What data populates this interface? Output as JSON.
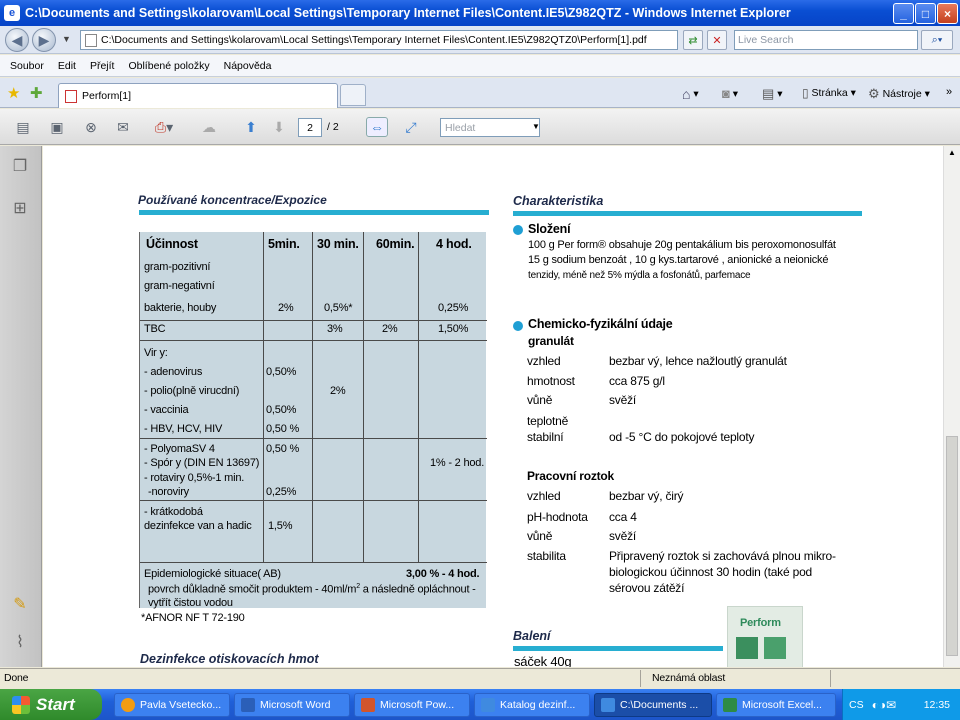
{
  "window": {
    "title": "C:\\Documents and Settings\\kolarovam\\Local Settings\\Temporary Internet Files\\Content.IE5\\Z982QTZ - Windows Internet Explorer",
    "address": "C:\\Documents and Settings\\kolarovam\\Local Settings\\Temporary Internet Files\\Content.IE5\\Z982QTZ0\\Perform[1].pdf",
    "search_placeholder": "Live Search"
  },
  "menu": [
    "Soubor",
    "Edit",
    "Přejít",
    "Oblíbené položky",
    "Nápověda"
  ],
  "tab": {
    "label": "Perform[1]"
  },
  "tools": {
    "page": "Stránka",
    "tools": "Nástroje"
  },
  "pdf": {
    "current_page": "2",
    "total": "/ 2",
    "find_placeholder": "Hledat"
  },
  "left": {
    "heading": "Používané koncentrace/Expozice",
    "headers": [
      "Účinnost",
      "5min.",
      "30 min.",
      "60min.",
      "4 hod."
    ],
    "r1": [
      "gram-pozitivní",
      "gram-negativní",
      "bakterie, houby",
      "2%",
      "0,5%*",
      "0,25%"
    ],
    "r2": [
      "TBC",
      "3%",
      "2%",
      "1,50%"
    ],
    "viry": [
      "Vir y:",
      "- adenovirus",
      "- polio(plně virucdní)",
      "- vaccinia",
      "- HBV, HCV, HIV"
    ],
    "viry_5": [
      "0,50%",
      "0,50%",
      "0,50 %"
    ],
    "viry_30": "2%",
    "r4": [
      "- PolyomaSV 4",
      "- Spór y (DIN EN   13697)",
      "- rotaviry 0,5%-1 min.",
      "-noroviry"
    ],
    "r4_5": [
      "0,50 %",
      "0,25%"
    ],
    "r4_4h": "1% - 2 hod.",
    "r5": [
      "- krátkodobá",
      " dezinfekce van a hadic"
    ],
    "r5_5": "1,5%",
    "epi": "Epidemiologické situace( AB)",
    "epi_val": "3,00 % - 4 hod.",
    "epi2": "povrch důkladně smočit produktem - 40ml/m",
    "epi2_sup": "2",
    "epi2b": " a následně opláchnout -",
    "epi3": "vytřít čistou vodou",
    "footnote": "*AFNOR NF T 72-190",
    "bottom_heading": "Dezinfekce otiskovacích hmot"
  },
  "right": {
    "heading": "Charakteristika",
    "slozeni_title": "Složení",
    "slozeni": [
      "100 g Per form® obsahuje 20g pentakálium bis peroxomonosulfát",
      "15 g sodium benzoát  , 10 g kys.tartarové  , anionické a neionické",
      "tenzidy, méně než 5% mýdla a fosfonátů, parfemace"
    ],
    "chem_title": "Chemicko-fyzikální údaje",
    "granulat": "granulát",
    "g_rows": [
      [
        "vzhled",
        "bezbar vý, lehce nažloutlý granulát"
      ],
      [
        "hmotnost",
        "cca 875 g/l"
      ],
      [
        "vůně",
        "svěží"
      ],
      [
        "teplotně",
        ""
      ],
      [
        "stabilní",
        "od -5 °C do pokojové teploty"
      ]
    ],
    "prac_title": "Pracovní roztok",
    "p_rows": [
      [
        "vzhled",
        "bezbar vý, čirý"
      ],
      [
        "pH-hodnota",
        "cca 4"
      ],
      [
        "vůně",
        "svěží"
      ],
      [
        "stabilita",
        "Připravený roztok si zachovává plnou mikro-"
      ]
    ],
    "p_extra": [
      "biologickou  účinnost  30  hodin  (také pod",
      "sérovou zátěží"
    ],
    "baleni": "Balení",
    "sacek": "sáček 40g",
    "logo": "Perform"
  },
  "status": {
    "left": "Done",
    "zone": "Neznámá oblast"
  },
  "taskbar": {
    "start": "Start",
    "items": [
      "Pavla Vsetecko...",
      "Microsoft Word",
      "Microsoft Pow...",
      "Katalog dezinf...",
      "C:\\Documents ...",
      "Microsoft Excel..."
    ],
    "lang": "CS",
    "clock": "12:35"
  }
}
